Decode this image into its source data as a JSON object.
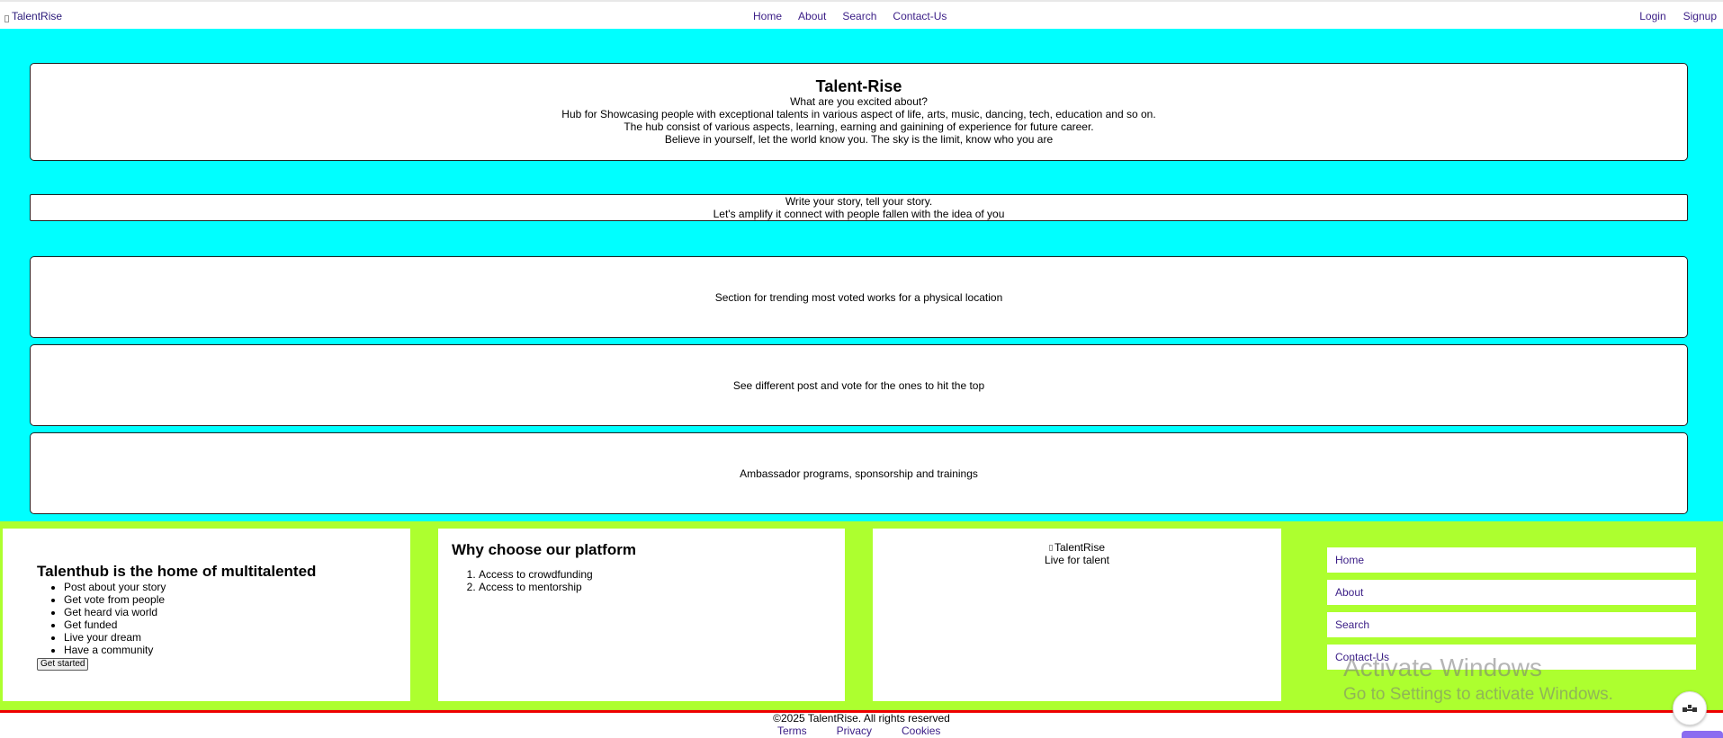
{
  "nav": {
    "brand": "TalentRise",
    "links": [
      "Home",
      "About",
      "Search",
      "Contact-Us"
    ],
    "login": "Login",
    "signup": "Signup"
  },
  "hero": {
    "title": "Talent-Rise",
    "lines": [
      "What are you excited about?",
      "Hub for Showcasing people with exceptional talents in various aspect of life, arts, music, dancing, tech, education and so on.",
      "The hub consist of various aspects, learning, earning and gainining of experience for future career.",
      "Believe in yourself, let the world know you. The sky is the limit, know who you are"
    ],
    "story_lines": [
      "Write your story, tell your story.",
      "Let's amplify it connect with people fallen with the idea of you"
    ],
    "sections": [
      "Section for trending most voted works for a physical location",
      "See different post and vote for the ones to hit the top",
      "Ambassador programs, sponsorship and trainings"
    ]
  },
  "footer": {
    "home_card": {
      "title": "Talenthub is the home of multitalented",
      "items": [
        "Post about your story",
        "Get vote from people",
        "Get heard via world",
        "Get funded",
        "Live your dream",
        "Have a community"
      ],
      "button": "Get started"
    },
    "why_card": {
      "title": "Why choose our platform",
      "items": [
        "Access to crowdfunding",
        "Access to mentorship"
      ]
    },
    "brand_card": {
      "brand": "TalentRise",
      "tagline": "Live for talent"
    },
    "links": [
      "Home",
      "About",
      "Search",
      "Contact-Us"
    ],
    "copyright": "©2025 TalentRise. All rights reserved",
    "bottom_links": [
      "Terms",
      "Privacy",
      "Cookies"
    ]
  },
  "watermark": {
    "line1": "Activate Windows",
    "line2": "Go to Settings to activate Windows."
  },
  "colors": {
    "hero_bg": "#00ffff",
    "footer_bg": "#adff2f",
    "divider": "#ee0000",
    "link": "#3a1d86"
  }
}
